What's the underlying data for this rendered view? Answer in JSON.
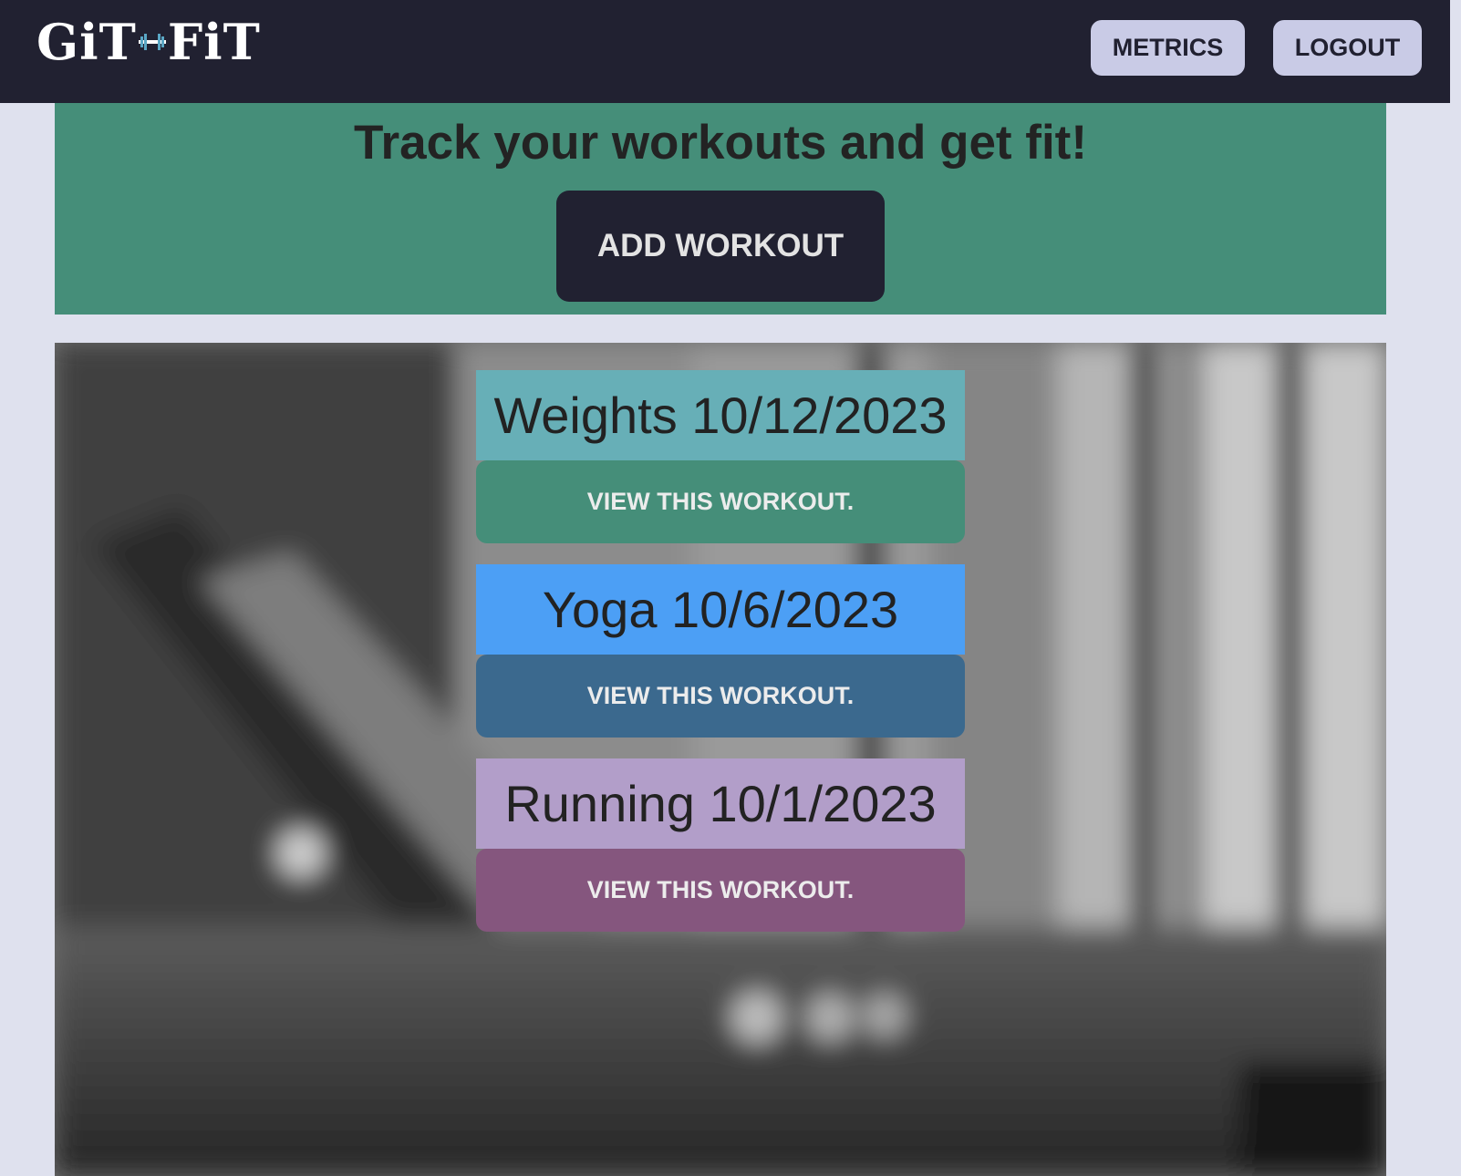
{
  "app": {
    "logo_left": "GiT",
    "logo_right": "FiT"
  },
  "nav": {
    "metrics_label": "METRICS",
    "logout_label": "LOGOUT"
  },
  "hero": {
    "title": "Track your workouts and get fit!",
    "add_button_label": "ADD WORKOUT"
  },
  "workouts": [
    {
      "title": "Weights 10/12/2023",
      "button_label": "VIEW THIS WORKOUT.",
      "title_color": "#67afb7",
      "button_color": "#458e79"
    },
    {
      "title": "Yoga 10/6/2023",
      "button_label": "VIEW THIS WORKOUT.",
      "title_color": "#4c9ff5",
      "button_color": "#3b698e"
    },
    {
      "title": "Running 10/1/2023",
      "button_label": "VIEW THIS WORKOUT.",
      "title_color": "#b29ec9",
      "button_color": "#85567e"
    }
  ],
  "colors": {
    "navbar": "#212131",
    "page_bg": "#dfe1ee",
    "hero_bg": "#458e79",
    "nav_button_bg": "#c9cbe6"
  }
}
